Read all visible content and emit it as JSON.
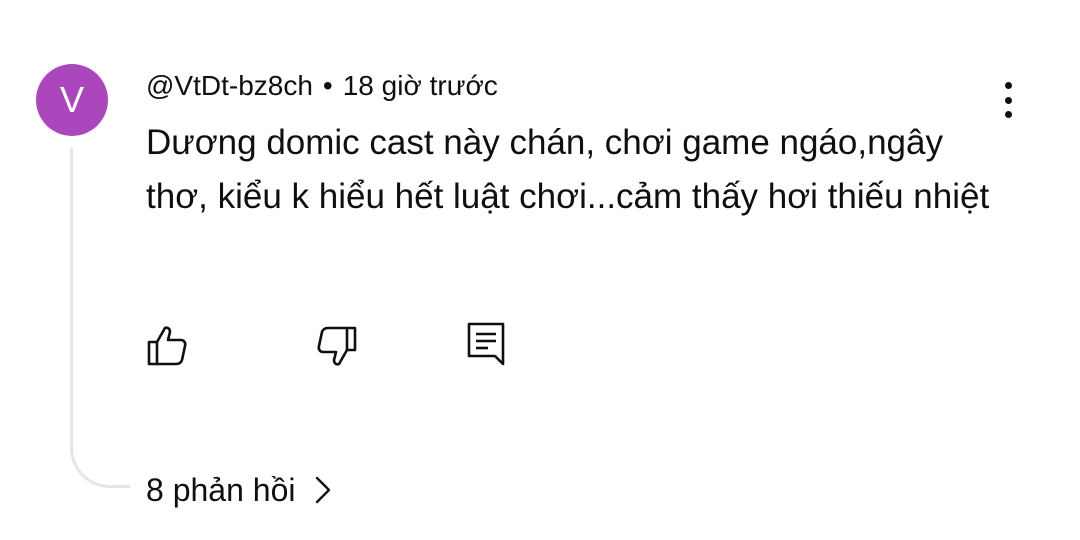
{
  "comment": {
    "avatar_letter": "V",
    "avatar_color": "#ab47bc",
    "author": "@VtDt-bz8ch",
    "separator": "•",
    "time_ago": "18 giờ trước",
    "text": "Dương domic cast này chán, chơi game ngáo,ngây thơ, kiểu k hiểu hết luật chơi...cảm thấy hơi thiếu nhiệt",
    "actions": {
      "like_icon": "thumbs-up-icon",
      "dislike_icon": "thumbs-down-icon",
      "reply_icon": "reply-comment-icon",
      "more_icon": "more-vertical-icon"
    },
    "replies_label": "8 phản hồi",
    "replies_icon": "chevron-right-icon",
    "thread_line_color": "#e5e5e5"
  }
}
